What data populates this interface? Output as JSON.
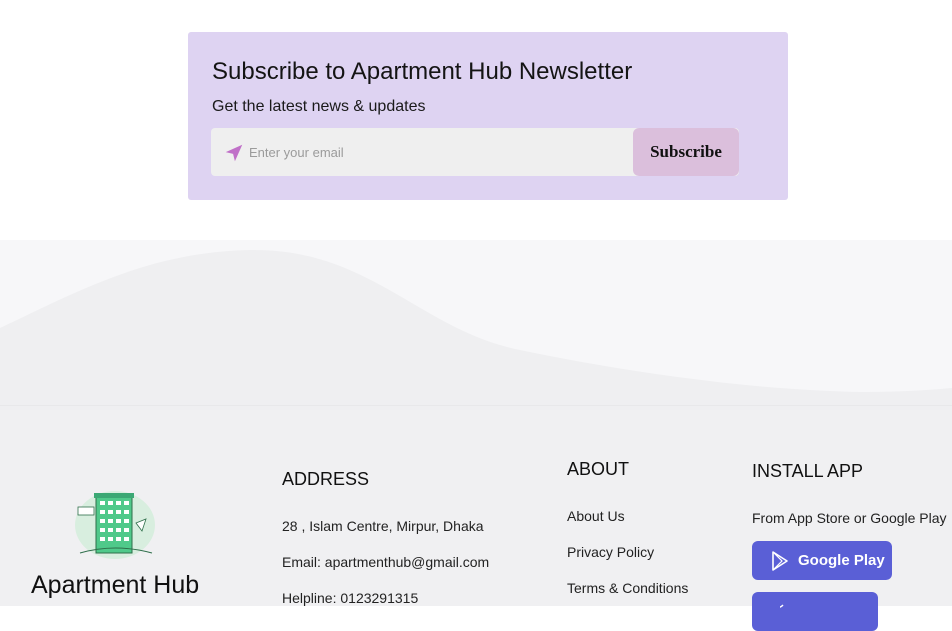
{
  "newsletter": {
    "title": "Subscribe to Apartment Hub Newsletter",
    "subtitle": "Get the latest news & updates",
    "email_placeholder": "Enter your email",
    "subscribe_label": "Subscribe"
  },
  "footer": {
    "brand": "Apartment Hub",
    "address": {
      "heading": "ADDRESS",
      "street": "28 , Islam Centre, Mirpur, Dhaka",
      "email": "Email: apartmenthub@gmail.com",
      "helpline": "Helpline: 0123291315"
    },
    "about": {
      "heading": "ABOUT",
      "links": [
        "About Us",
        "Privacy Policy",
        "Terms & Conditions"
      ]
    },
    "install": {
      "heading": "INSTALL APP",
      "text": "From App Store or Google Play",
      "google_play_label": "Google Play",
      "app_store_label": ""
    }
  },
  "colors": {
    "newsletter_bg": "#ded3f2",
    "subscribe_bg": "#dbbfdc",
    "send_icon": "#c070c8",
    "store_button": "#5a5fd6"
  },
  "icons": {
    "send": "paper-plane-icon",
    "google_play": "google-play-icon",
    "apple": "apple-icon",
    "logo": "apartment-building-logo"
  }
}
